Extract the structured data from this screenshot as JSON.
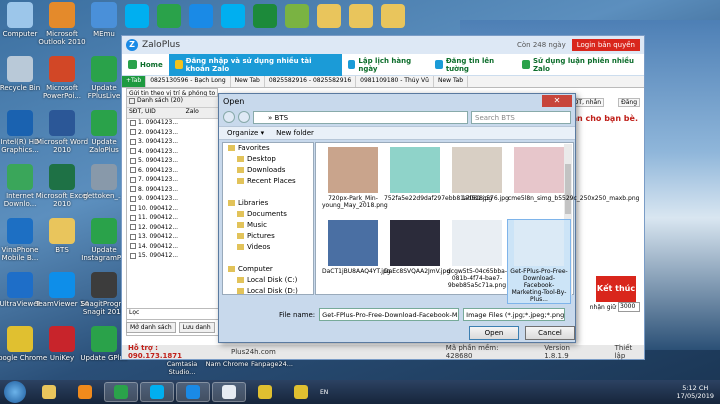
{
  "desktop_icons": [
    {
      "label": "Computer",
      "icon": "computer-icon",
      "color": "#9cc6ea"
    },
    {
      "label": "Microsoft Outlook 2010",
      "icon": "outlook-icon",
      "color": "#e48a2b"
    },
    {
      "label": "MEmu",
      "icon": "memu-icon",
      "color": "#4a90d9"
    },
    {
      "label": "Recycle Bin",
      "icon": "recycle-bin-icon",
      "color": "#b9c9d8"
    },
    {
      "label": "Microsoft PowerPoi...",
      "icon": "powerpoint-icon",
      "color": "#d24726"
    },
    {
      "label": "Update FPlusLive",
      "icon": "fplus-icon",
      "color": "#2aa24a"
    },
    {
      "label": "Intel(R) HD Graphics...",
      "icon": "intel-icon",
      "color": "#1a62b0"
    },
    {
      "label": "Microsoft Word 2010",
      "icon": "word-icon",
      "color": "#2b5797"
    },
    {
      "label": "Update ZaloPlus",
      "icon": "zaloplus-icon",
      "color": "#2aa24a"
    },
    {
      "label": "Internet Downlo...",
      "icon": "idm-icon",
      "color": "#3aa65a"
    },
    {
      "label": "Microsoft Excel 2010",
      "icon": "excel-icon",
      "color": "#1e7145"
    },
    {
      "label": "gettoken_...",
      "icon": "gettoken-icon",
      "color": "#8899aa"
    },
    {
      "label": "VinaPhone Mobile B...",
      "icon": "vinaphone-icon",
      "color": "#1d6fc3"
    },
    {
      "label": "BTS",
      "icon": "folder-icon",
      "color": "#e9c55c"
    },
    {
      "label": "Update InstagramP...",
      "icon": "instagram-update-icon",
      "color": "#2aa24a"
    },
    {
      "label": "UltraViewer",
      "icon": "ultraviewer-icon",
      "color": "#1e6ec8"
    },
    {
      "label": "TeamViewer 14",
      "icon": "teamviewer-icon",
      "color": "#0e8ee9"
    },
    {
      "label": "SnagitProgr... Snagit 2019",
      "icon": "snagit-icon",
      "color": "#3c3c3c"
    },
    {
      "label": "Google Chrome",
      "icon": "chrome-icon",
      "color": "#e0c030"
    },
    {
      "label": "UniKey",
      "icon": "unikey-icon",
      "color": "#c8242b"
    },
    {
      "label": "Update GPlus",
      "icon": "gplus-update-icon",
      "color": "#2aa24a"
    }
  ],
  "top_icons": [
    {
      "label": "Skype",
      "color": "#00aff0"
    },
    {
      "label": "Camtasia",
      "color": "#2aa24a"
    },
    {
      "label": "Zalo",
      "color": "#1a8ae6"
    },
    {
      "label": "Skype",
      "color": "#00aff0"
    },
    {
      "label": "Camtasia",
      "color": "#1c8a3a"
    },
    {
      "label": "Studio",
      "color": "#7ab342"
    },
    {
      "label": "Folder",
      "color": "#e9c55c"
    },
    {
      "label": "Folder",
      "color": "#e9c55c"
    },
    {
      "label": "Folder",
      "color": "#e9c55c"
    }
  ],
  "zalo": {
    "title": "ZaloPlus",
    "online": "Còn 248 ngày",
    "login": "Login bản quyền",
    "menu": [
      {
        "label": "Home",
        "active": false,
        "color": "#2aa24a"
      },
      {
        "label": "Đăng nhập và sử dụng nhiều tài khoản Zalo",
        "active": true,
        "color": "#f3c21c"
      },
      {
        "label": "Lập lịch hàng ngày",
        "active": false,
        "color": "#1b9bd7"
      },
      {
        "label": "Đăng tin lên tường",
        "active": false,
        "color": "#1b9bd7"
      },
      {
        "label": "Sử dụng luận phiên nhiều Zalo",
        "active": false,
        "color": "#2aa24a"
      }
    ],
    "tabs": [
      {
        "label": "+Tab",
        "green": true
      },
      {
        "label": "0825130596 - Bạch Long",
        "green": false
      },
      {
        "label": "New Tab",
        "green": false
      },
      {
        "label": "0825582916 - 0825582916",
        "green": false
      },
      {
        "label": "0981109180 - Thủy Vũ",
        "green": false
      },
      {
        "label": "New Tab",
        "green": false
      }
    ],
    "subtab": "Gửi tin theo vị trí & phóng to",
    "list_header": "Danh sách (20)",
    "list_col_sdt": "SĐT, UID",
    "list_col_zalo": "Zalo",
    "list_rows": [
      "1. 0904123...",
      "2. 0904123...",
      "3. 0904123...",
      "4. 0904123...",
      "5. 0904123...",
      "6. 0904123...",
      "7. 0904123...",
      "8. 0904123...",
      "9. 0904123...",
      "10. 090412...",
      "11. 090412...",
      "12. 090412...",
      "13. 090412...",
      "14. 090412...",
      "15. 090412..."
    ],
    "filter_label": "Lọc",
    "btn_list": "Mở danh sách",
    "btn_save": "Lưu danh",
    "stop_btn": "Kết thúc",
    "right_header": "nhắn cho bạn bè.",
    "right_tab1": "SĐT, nhắn",
    "right_tab2": "Đăng",
    "wait_label": "nhận giữ",
    "wait_value": "3000",
    "hotline": "Hỗ trợ : 090.173.1871",
    "site": "Plus24h.com",
    "machine_code": "Mã phần mềm: 428680",
    "version": "Version 1.8.1.9",
    "settings": "Thiết lập"
  },
  "dialog": {
    "title": "Open",
    "path_root": "»",
    "path_folder": "BTS",
    "search_placeholder": "Search BTS",
    "organize": "Organize ▾",
    "new_folder": "New folder",
    "nav": [
      {
        "label": "Favorites",
        "head": true
      },
      {
        "label": "Desktop",
        "head": false
      },
      {
        "label": "Downloads",
        "head": false
      },
      {
        "label": "Recent Places",
        "head": false
      },
      {
        "label": "",
        "head": false
      },
      {
        "label": "Libraries",
        "head": true
      },
      {
        "label": "Documents",
        "head": false
      },
      {
        "label": "Music",
        "head": false
      },
      {
        "label": "Pictures",
        "head": false
      },
      {
        "label": "Videos",
        "head": false
      },
      {
        "label": "",
        "head": false
      },
      {
        "label": "Computer",
        "head": true
      },
      {
        "label": "Local Disk (C:)",
        "head": false
      },
      {
        "label": "Local Disk (D:)",
        "head": false
      }
    ],
    "files": [
      {
        "name": "720px-Park_Min-young_May_2018.png",
        "color": "#c9a48c",
        "selected": false
      },
      {
        "name": "752fa5e22d9daf297ebb81ad518c576.jpg",
        "color": "#8fd3c9",
        "selected": false
      },
      {
        "name": "17081.jpg",
        "color": "#d8cfc4",
        "selected": false
      },
      {
        "name": "cme5l8n_simg_b5529c_250x250_maxb.png",
        "color": "#e7c6cb",
        "selected": false
      },
      {
        "name": "DaCT1jBU8AAQ4YT.jpg",
        "color": "#4a6fa3",
        "selected": false
      },
      {
        "name": "DaEc8SVQAA2JmV.jpg",
        "color": "#2b2b3a",
        "selected": false
      },
      {
        "name": "dcgw5t5-04c65bba-081b-4f74-bae7-9beb85a5c71a.png",
        "color": "#e9eef3",
        "selected": false
      },
      {
        "name": "Get-FPlus-Pro-Free-Download-Facebook-Marketing-Tool-By-Plus...",
        "color": "#dbeaf6",
        "selected": true
      }
    ],
    "file_name_label": "File name:",
    "file_name_value": "Get-FPlus-Pro-Free-Download-Facebook-Ma",
    "file_type_value": "Image Files (*.jpg;*.jpeg;*.png;*",
    "open_btn": "Open",
    "cancel_btn": "Cancel"
  },
  "taskbar": {
    "apps": [
      {
        "icon": "explorer-icon",
        "color": "#e9c55c",
        "active": false
      },
      {
        "icon": "media-player-icon",
        "color": "#f08a1c",
        "active": false
      },
      {
        "icon": "camtasia-icon",
        "color": "#2aa24a",
        "active": true
      },
      {
        "icon": "skype-icon",
        "color": "#00aff0",
        "active": true
      },
      {
        "icon": "zalo-icon",
        "color": "#1a8ae6",
        "active": true
      },
      {
        "icon": "zaloplus-icon",
        "color": "#e7ecf3",
        "active": true
      },
      {
        "icon": "chrome-icon",
        "color": "#e0c030",
        "active": false
      },
      {
        "icon": "chrome-icon",
        "color": "#e0c030",
        "active": false
      }
    ],
    "lang": "EN",
    "time": "5:12 CH",
    "date": "17/05/2019"
  },
  "bottom_desktop_labels": [
    "Camtasia Studio...",
    "Nam Chrome",
    "Fanpage24..."
  ]
}
